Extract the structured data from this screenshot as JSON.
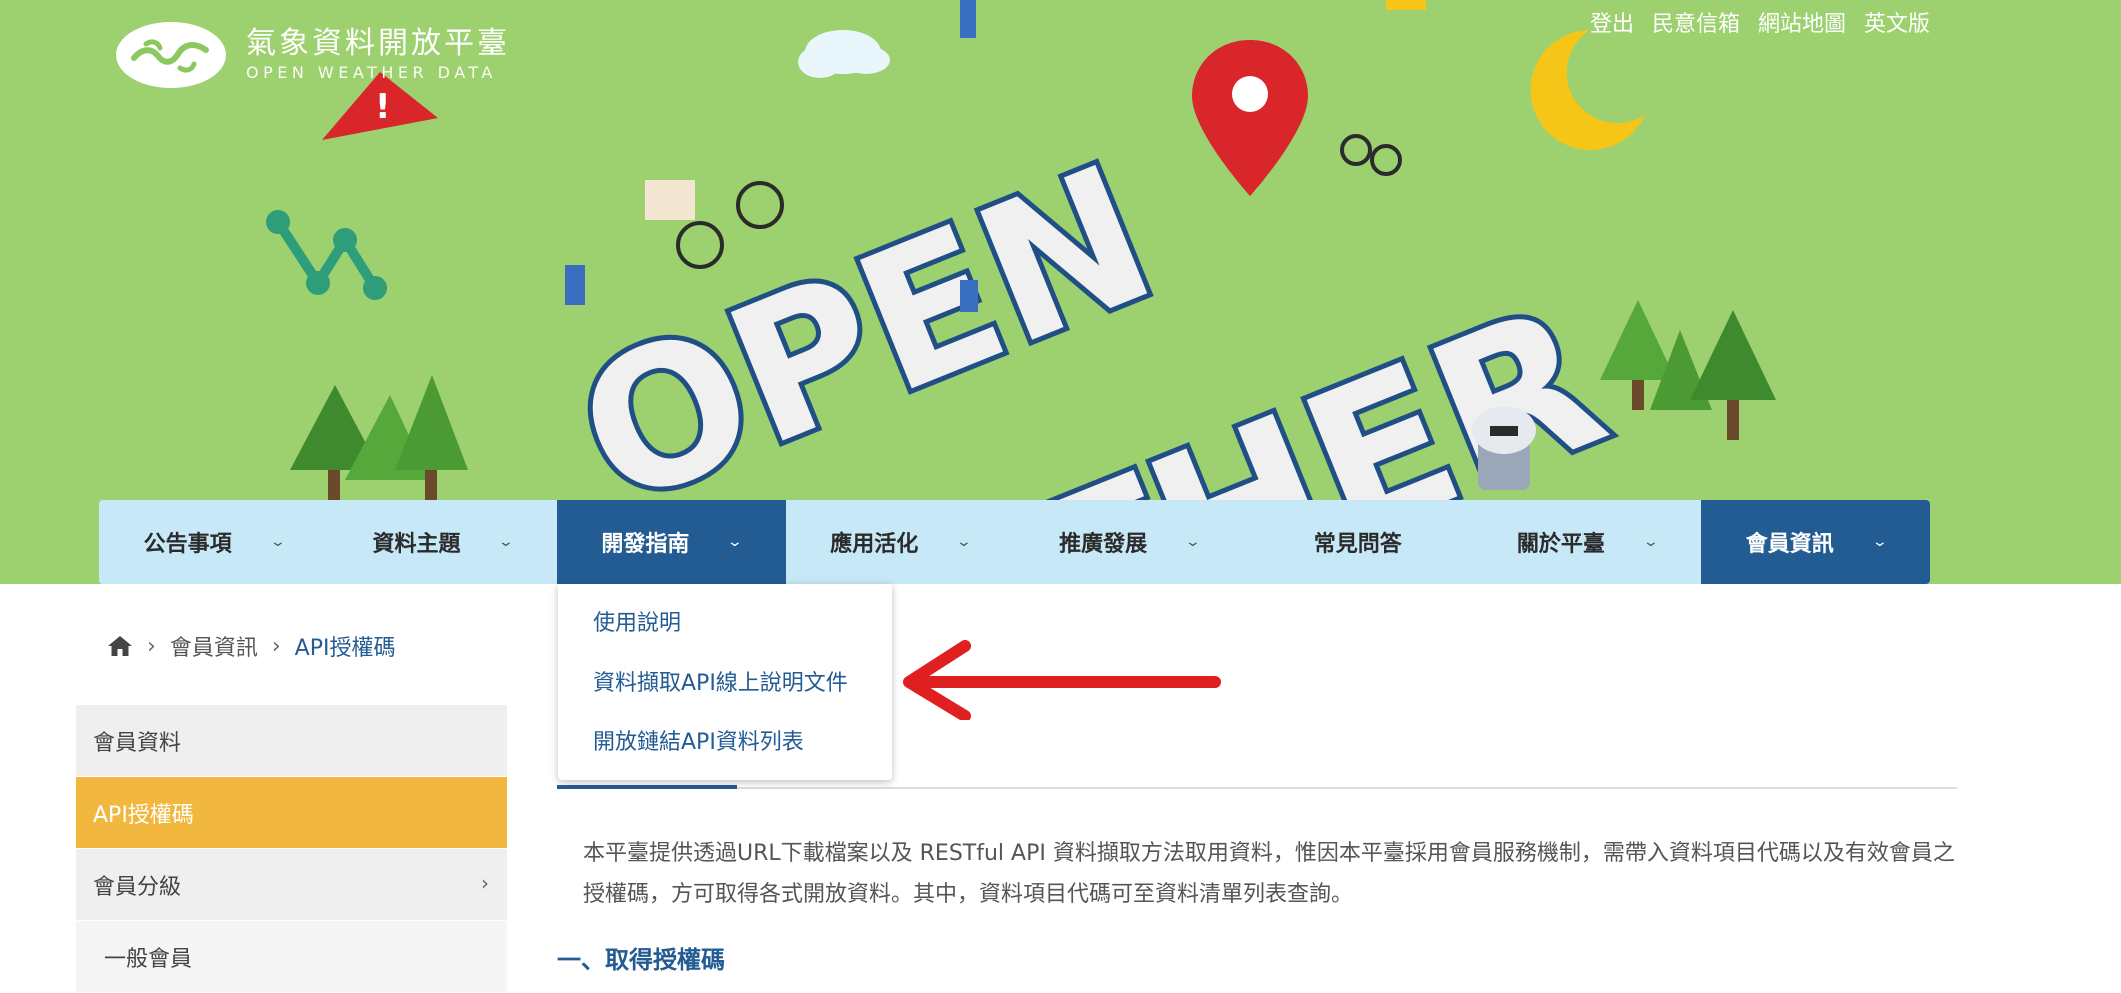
{
  "site": {
    "title": "氣象資料開放平臺",
    "subtitle": "OPEN WEATHER DATA"
  },
  "toplinks": [
    "登出",
    "民意信箱",
    "網站地圖",
    "英文版"
  ],
  "nav": {
    "items": [
      {
        "label": "公告事項",
        "has_dropdown": true
      },
      {
        "label": "資料主題",
        "has_dropdown": true
      },
      {
        "label": "開發指南",
        "has_dropdown": true,
        "active": true
      },
      {
        "label": "應用活化",
        "has_dropdown": true
      },
      {
        "label": "推廣發展",
        "has_dropdown": true
      },
      {
        "label": "常見問答",
        "has_dropdown": false
      },
      {
        "label": "關於平臺",
        "has_dropdown": true
      },
      {
        "label": "會員資訊",
        "has_dropdown": true
      }
    ],
    "chevron": "⌄"
  },
  "dropdown": {
    "items": [
      "使用說明",
      "資料擷取API線上說明文件",
      "開放鏈結API資料列表"
    ]
  },
  "breadcrumb": {
    "items": [
      "會員資訊",
      "API授權碼"
    ],
    "separator": "›"
  },
  "sidebar": {
    "items": [
      {
        "label": "會員資料"
      },
      {
        "label": "API授權碼",
        "active": true
      },
      {
        "label": "會員分級",
        "caret": "›"
      },
      {
        "label": "一般會員"
      }
    ]
  },
  "content": {
    "intro": "本平臺提供透過URL下載檔案以及 RESTful API 資料擷取方法取用資料，惟因本平臺採用會員服務機制，需帶入資料項目代碼以及有效會員之授權碼，方可取得各式開放資料。其中，資料項目代碼可至資料清單列表查詢。",
    "section_title": "一、取得授權碼"
  },
  "colors": {
    "hero_bg": "#9dd06f",
    "nav_bg": "#c7e8f6",
    "nav_active": "#235b93",
    "sidebar_active": "#f2b73f",
    "link": "#235b93",
    "arrow": "#e02020"
  },
  "icons": {
    "home": "home-icon",
    "arrow": "red-arrow-annotation"
  }
}
